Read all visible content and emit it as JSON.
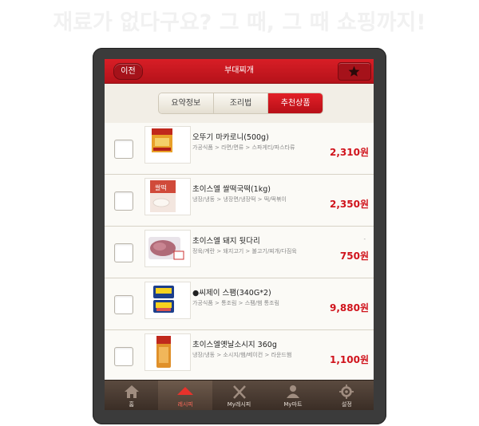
{
  "headline": "재료가 없다구요? 그 때, 그 때 쇼핑까지!",
  "header": {
    "back_label": "이전",
    "title": "부대찌개",
    "favorite_icon": "star-icon"
  },
  "tabs": [
    {
      "label": "요약정보",
      "active": false
    },
    {
      "label": "조리법",
      "active": false
    },
    {
      "label": "추천상품",
      "active": true
    }
  ],
  "products": [
    {
      "name": "오뚜기 마카로니(500g)",
      "category": "가공식품 > 라면/면류 > 스파게티/파스타류",
      "price": "2,310원",
      "note": ""
    },
    {
      "name": "초이스엘 쌀떡국떡(1kg)",
      "category": "냉장/냉동 > 냉장면/냉장떡 > 떡/떡볶이",
      "price": "2,350원",
      "note": ""
    },
    {
      "name": "초이스엘 돼지 뒷다리",
      "category": "정육/계란 > 돼지고기 > 불고기/찌개/다짐육",
      "price": "750원",
      "note": "-"
    },
    {
      "name": "●씨제이 스팸(340G*2)",
      "category": "가공식품 > 통조림 > 스팸/햄 통조림",
      "price": "9,880원",
      "note": ""
    },
    {
      "name": "초이스엘옛날소시지 360g",
      "category": "냉장/냉동 > 소시지/햄/베이컨 > 라운드햄",
      "price": "1,100원",
      "note": ""
    }
  ],
  "nav": [
    {
      "label": "홈",
      "icon": "home-icon",
      "active": false
    },
    {
      "label": "레시피",
      "icon": "recipe-icon",
      "active": true
    },
    {
      "label": "My레시피",
      "icon": "fork-knife-icon",
      "active": false
    },
    {
      "label": "My마트",
      "icon": "user-icon",
      "active": false
    },
    {
      "label": "설정",
      "icon": "gear-icon",
      "active": false
    }
  ],
  "colors": {
    "brand_red": "#d81e26",
    "price_red": "#d0131c",
    "navbar_brown": "#4a3a30"
  }
}
